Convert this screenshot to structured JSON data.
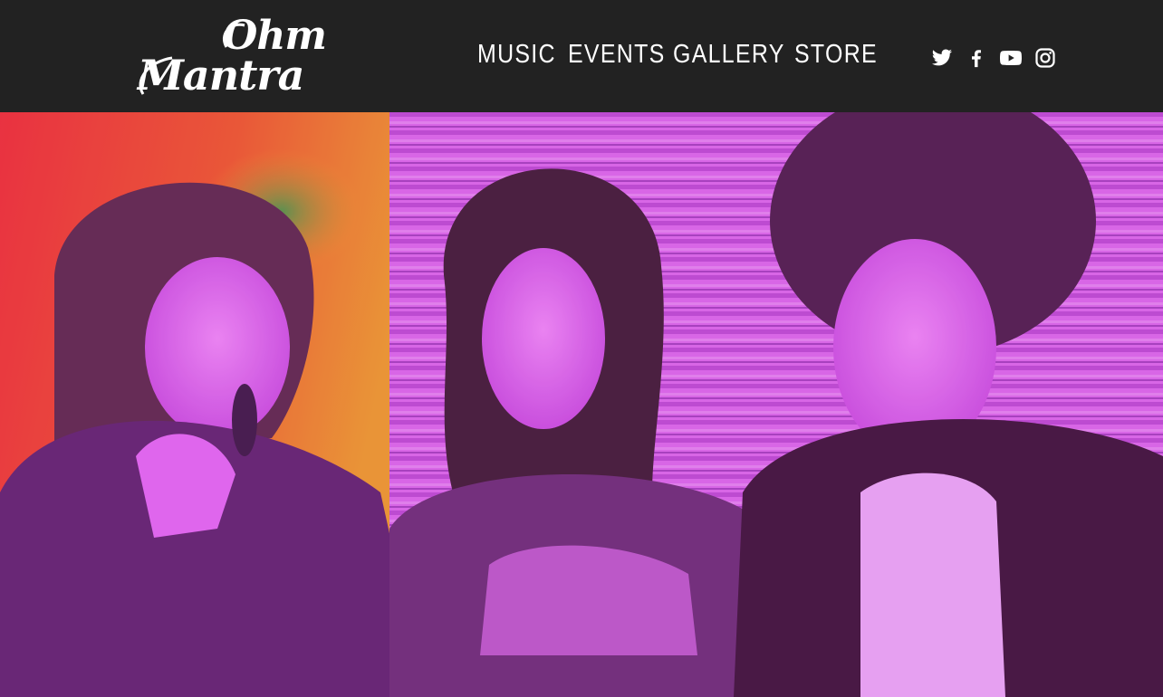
{
  "brand": {
    "logo_line1": "Ohm",
    "logo_line2": "Mantra"
  },
  "nav": {
    "items": [
      {
        "label": "MUSIC"
      },
      {
        "label": "EVENTS"
      },
      {
        "label": "GALLERY"
      },
      {
        "label": "STORE"
      }
    ]
  },
  "social": {
    "icons": [
      "twitter-icon",
      "facebook-icon",
      "youtube-icon",
      "instagram-icon"
    ]
  },
  "colors": {
    "header_bg": "#222222",
    "text": "#ffffff",
    "hero_magenta": "#d44ef0",
    "hero_red": "#f03a2a",
    "hero_orange": "#f08c1c"
  }
}
